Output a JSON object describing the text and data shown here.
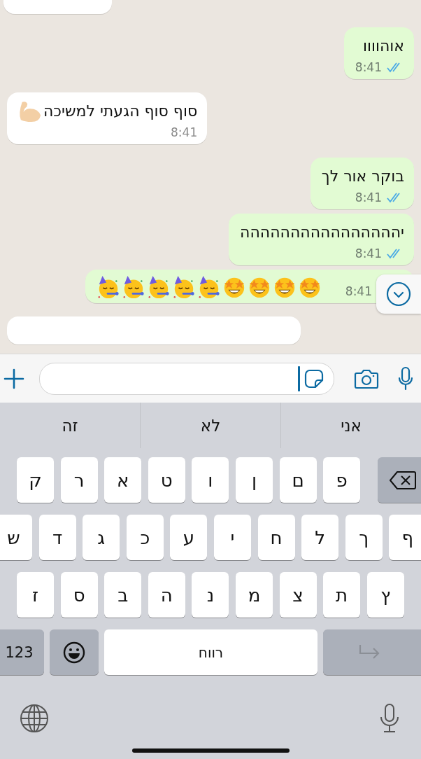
{
  "chat": {
    "messages": [
      {
        "outgoing": false,
        "kind": "clipped"
      },
      {
        "outgoing": true,
        "kind": "text",
        "text": "אוהוווו",
        "time": "8:41",
        "read": true
      },
      {
        "outgoing": false,
        "kind": "text",
        "text": "סוף סוף הגעתי למשיכה",
        "emoji": [
          {
            "kind": "flexed-arm"
          }
        ],
        "time": "8:41"
      },
      {
        "outgoing": true,
        "kind": "text",
        "text": "בוקר אור לך",
        "time": "8:41",
        "read": true
      },
      {
        "outgoing": true,
        "kind": "text",
        "text": "יהההההההההההההההה",
        "time": "8:41",
        "read": true
      },
      {
        "outgoing": true,
        "kind": "emoji",
        "emoji": [
          {
            "kind": "party"
          },
          {
            "kind": "party"
          },
          {
            "kind": "party"
          },
          {
            "kind": "party"
          },
          {
            "kind": "party"
          },
          {
            "kind": "star-eyes"
          },
          {
            "kind": "star-eyes"
          },
          {
            "kind": "star-eyes"
          },
          {
            "kind": "star-eyes"
          }
        ],
        "time": "8:41"
      },
      {
        "outgoing": false,
        "kind": "clipped"
      }
    ]
  },
  "composer": {
    "focused": true
  },
  "keyboard": {
    "suggestions": [
      {
        "text": "אני"
      },
      {
        "text": "לא"
      },
      {
        "text": "זה"
      }
    ],
    "rows": [
      [
        "פ",
        "ם",
        "ן",
        "ו",
        "ט",
        "א",
        "ר",
        "ק"
      ],
      [
        "ף",
        "ך",
        "ל",
        "ח",
        "י",
        "ע",
        "כ",
        "ג",
        "ד",
        "ש"
      ],
      [
        "ץ",
        "ת",
        "צ",
        "מ",
        "נ",
        "ה",
        "ב",
        "ס",
        "ז"
      ]
    ],
    "bottom_row": {
      "numbers_key": "123",
      "space_key": "רווח",
      "return_disabled": true
    }
  }
}
